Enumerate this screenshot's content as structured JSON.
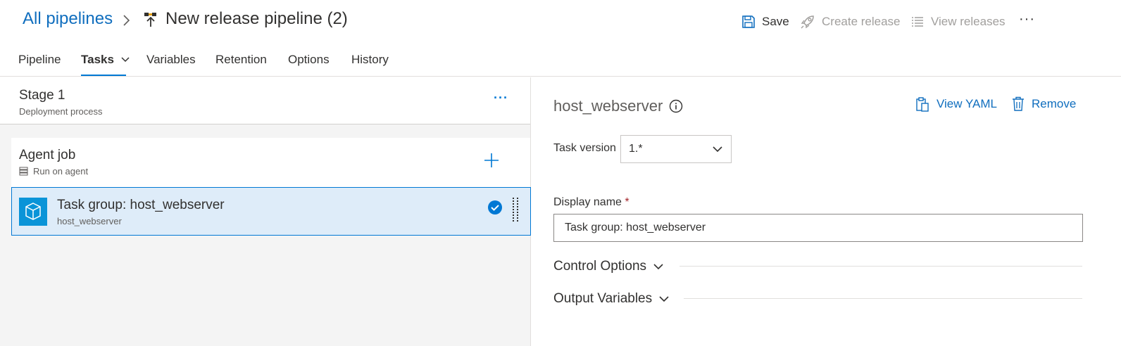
{
  "breadcrumb": {
    "root": "All pipelines",
    "title": "New release pipeline (2)"
  },
  "commands": {
    "save": "Save",
    "create_release": "Create release",
    "view_releases": "View releases",
    "more": "···"
  },
  "tabs": [
    {
      "label": "Pipeline"
    },
    {
      "label": "Tasks"
    },
    {
      "label": "Variables"
    },
    {
      "label": "Retention"
    },
    {
      "label": "Options"
    },
    {
      "label": "History"
    }
  ],
  "stage": {
    "title": "Stage 1",
    "subtitle": "Deployment process",
    "more": "···"
  },
  "agent_job": {
    "title": "Agent job",
    "subtitle": "Run on agent"
  },
  "task": {
    "title": "Task group: host_webserver",
    "subtitle": "host_webserver"
  },
  "details": {
    "title": "host_webserver",
    "view_yaml": "View YAML",
    "remove": "Remove",
    "task_version_label": "Task version",
    "task_version_value": "1.*",
    "display_name_label": "Display name",
    "required_marker": "*",
    "display_name_value": "Task group: host_webserver",
    "control_options": "Control Options",
    "output_variables": "Output Variables"
  },
  "colors": {
    "accent": "#0078d4",
    "link": "#106ebe",
    "selected_bg": "#deecf9",
    "task_icon_bg": "#0a94d8",
    "disabled": "#a19f9d"
  }
}
